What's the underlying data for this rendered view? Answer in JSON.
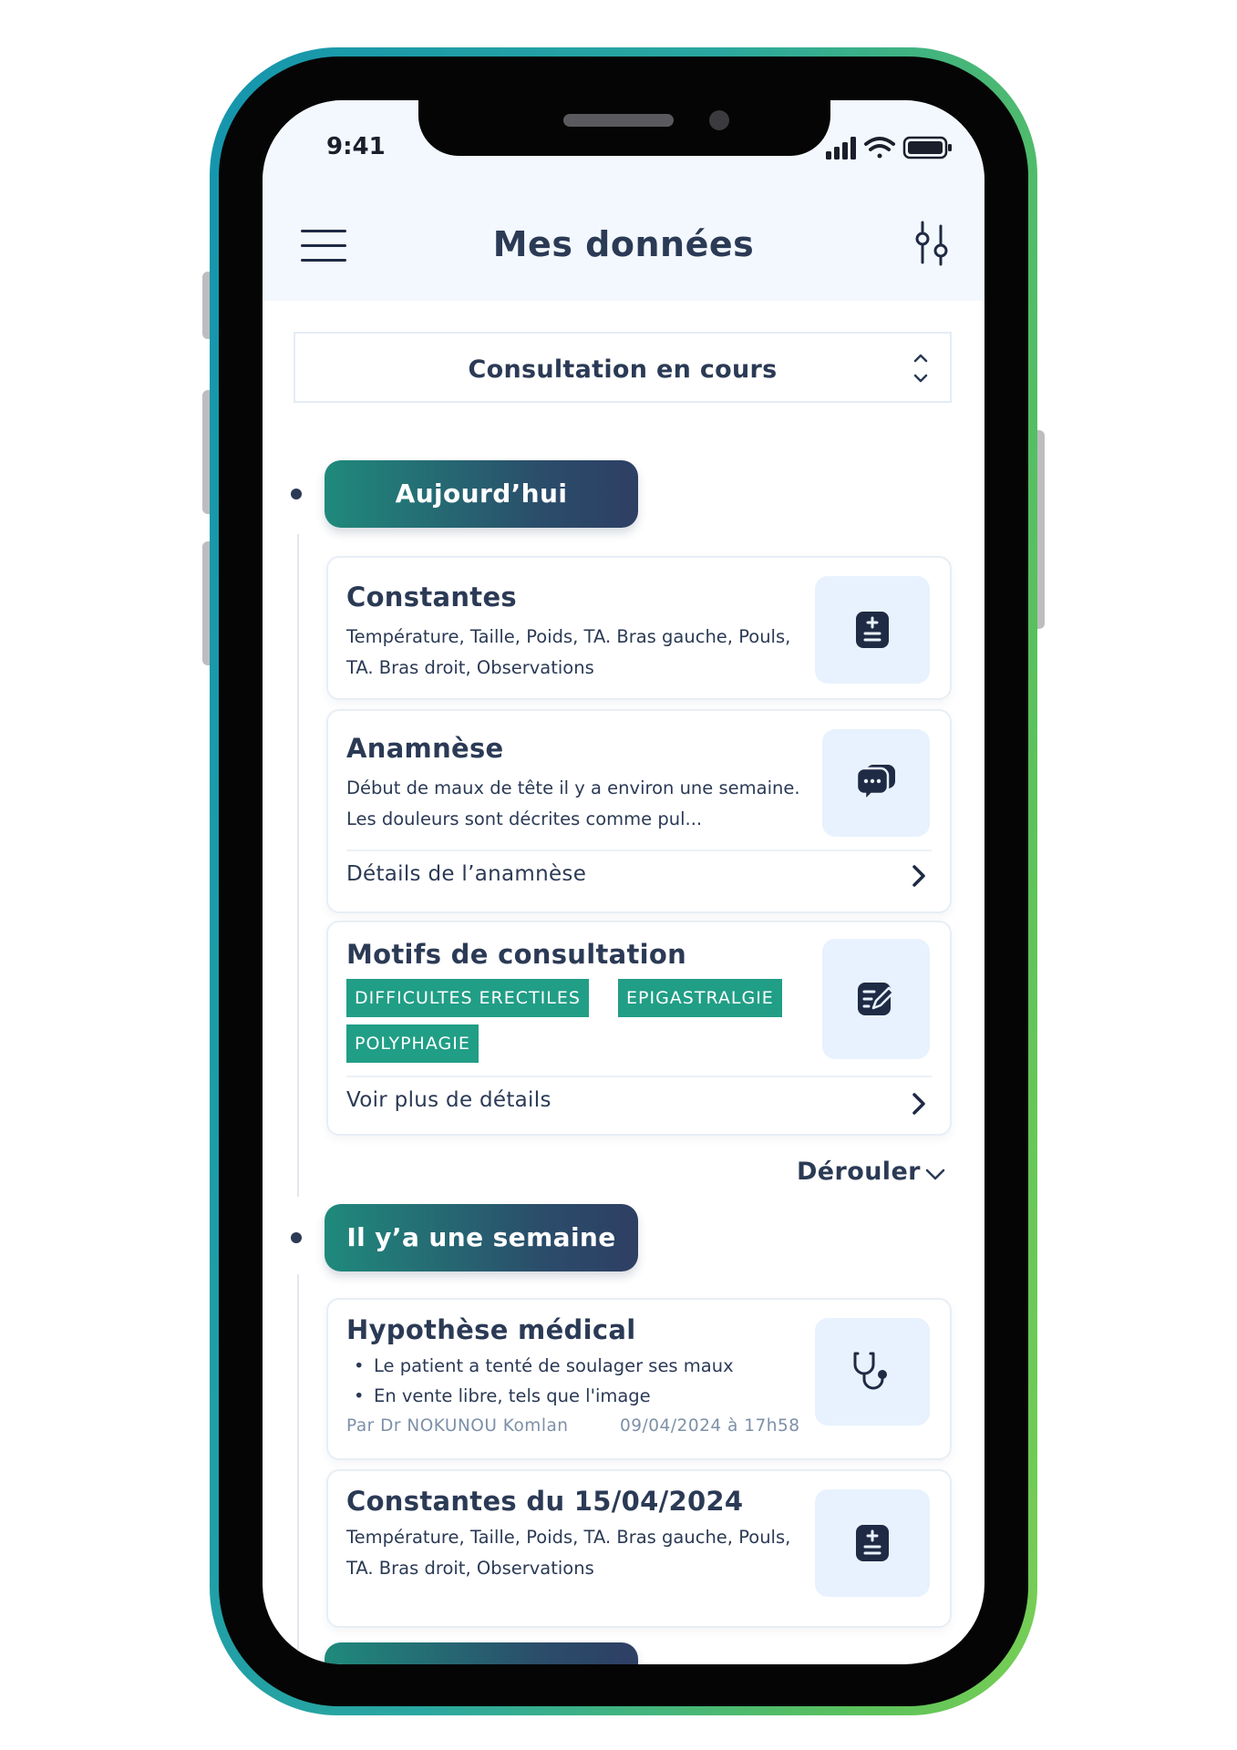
{
  "status_bar": {
    "time": "9:41"
  },
  "header": {
    "title": "Mes données"
  },
  "selector": {
    "label": "Consultation en cours"
  },
  "groups": [
    {
      "label": "Aujourd’hui"
    },
    {
      "label": "Il y’a une semaine"
    }
  ],
  "cards": {
    "constantes": {
      "title": "Constantes",
      "text": "Température, Taille, Poids, TA. Bras gauche, Pouls, TA. Bras droit, Observations",
      "icon": "clipboard-plus-icon"
    },
    "anamnese": {
      "title": "Anamnèse",
      "text": "Début de maux de tête il y a environ une semaine. Les douleurs sont décrites comme pul...",
      "link": "Détails de l’anamnèse",
      "icon": "chat-bubbles-icon"
    },
    "motifs": {
      "title": "Motifs de consultation",
      "tags": [
        "DIFFICULTES ERECTILES",
        "EPIGASTRALGIE",
        "POLYPHAGIE"
      ],
      "link": "Voir plus de détails",
      "icon": "edit-note-icon"
    },
    "hypothese": {
      "title": "Hypothèse médical",
      "bullets": [
        "Le patient a tenté de soulager ses maux",
        "En vente libre, tels que l'image"
      ],
      "author": "Par Dr NOKUNOU Komlan",
      "date": "09/04/2024 à 17h58",
      "icon": "stethoscope-icon"
    },
    "constantes_date": {
      "title": "Constantes du 15/04/2024",
      "text": "Température, Taille, Poids, TA. Bras gauche, Pouls, TA. Bras droit, Observations",
      "icon": "clipboard-plus-icon"
    }
  },
  "unroll": {
    "label": "Dérouler"
  },
  "colors": {
    "primary_text": "#2b3a55",
    "tag_green": "#219e86",
    "icon_box": "#e8f2fe",
    "pill_gradient_start": "#1f8a7c",
    "pill_gradient_end": "#2e3f64",
    "frame_gradient_start": "#1595ad",
    "frame_gradient_end": "#79cf55"
  }
}
